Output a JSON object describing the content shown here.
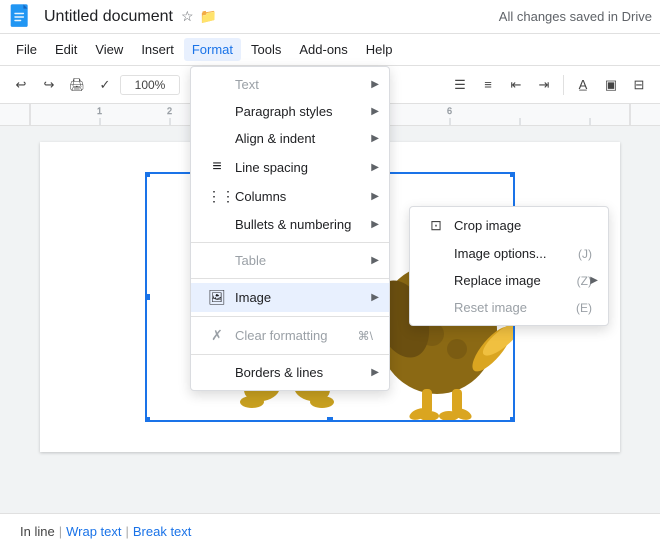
{
  "title_bar": {
    "doc_title": "Untitled document",
    "saved_status": "All changes saved in Drive"
  },
  "menu_bar": {
    "items": [
      {
        "label": "File",
        "id": "file"
      },
      {
        "label": "Edit",
        "id": "edit"
      },
      {
        "label": "View",
        "id": "view"
      },
      {
        "label": "Insert",
        "id": "insert"
      },
      {
        "label": "Format",
        "id": "format",
        "active": true
      },
      {
        "label": "Tools",
        "id": "tools"
      },
      {
        "label": "Add-ons",
        "id": "addons"
      },
      {
        "label": "Help",
        "id": "help"
      }
    ]
  },
  "toolbar": {
    "zoom": "100%"
  },
  "format_menu": {
    "items": [
      {
        "label": "Text",
        "id": "text",
        "icon": "",
        "disabled": true,
        "has_submenu": true
      },
      {
        "label": "Paragraph styles",
        "id": "paragraph-styles",
        "icon": "",
        "has_submenu": true
      },
      {
        "label": "Align & indent",
        "id": "align-indent",
        "icon": "",
        "has_submenu": true
      },
      {
        "label": "Line spacing",
        "id": "line-spacing",
        "icon": "≡",
        "has_submenu": true
      },
      {
        "label": "Columns",
        "id": "columns",
        "icon": "⋮⋮",
        "has_submenu": true
      },
      {
        "label": "Bullets & numbering",
        "id": "bullets-numbering",
        "icon": "",
        "has_submenu": true
      },
      {
        "label": "Table",
        "id": "table",
        "icon": "",
        "disabled": true,
        "has_submenu": true
      },
      {
        "label": "Image",
        "id": "image",
        "icon": "🖼",
        "has_submenu": true,
        "highlighted": true
      },
      {
        "label": "Clear formatting",
        "id": "clear-formatting",
        "icon": "✗",
        "disabled": true,
        "shortcut": "⌘\\"
      },
      {
        "label": "Borders & lines",
        "id": "borders-lines",
        "icon": "",
        "has_submenu": true
      }
    ]
  },
  "image_submenu": {
    "items": [
      {
        "label": "Crop image",
        "id": "crop-image",
        "icon": "⊡"
      },
      {
        "label": "Image options...",
        "id": "image-options",
        "shortcut": "(J)"
      },
      {
        "label": "Replace image",
        "id": "replace-image",
        "shortcut": "(Z)",
        "has_submenu": true
      },
      {
        "label": "Reset image",
        "id": "reset-image",
        "shortcut": "(E)",
        "disabled": true
      }
    ]
  },
  "status_bar": {
    "inline_label": "In line",
    "wrap_text_label": "Wrap text",
    "break_text_label": "Break text",
    "separator": "|"
  }
}
